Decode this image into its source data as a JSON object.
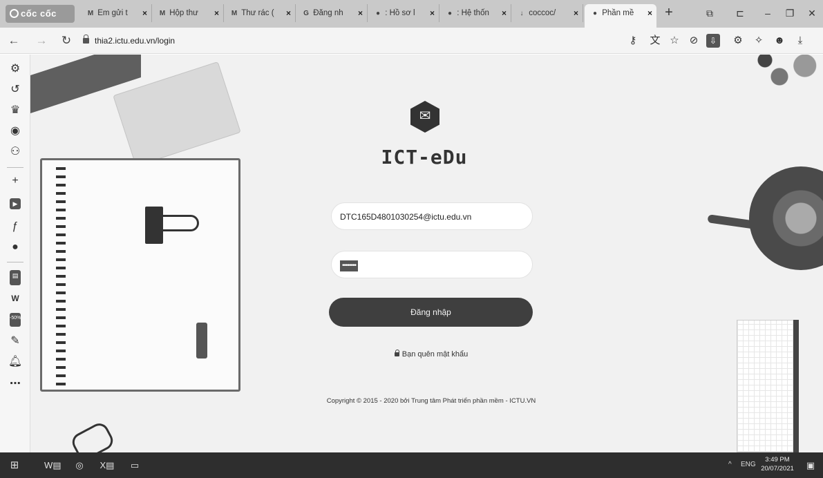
{
  "browser": {
    "brand": "cốc cốc",
    "tabs": [
      {
        "icon": "M",
        "title": "Em gửi t"
      },
      {
        "icon": "M",
        "title": "Hộp thư"
      },
      {
        "icon": "M",
        "title": "Thư rác ("
      },
      {
        "icon": "G",
        "title": "Đăng nh"
      },
      {
        "icon": "●",
        "title": ": Hồ sơ l"
      },
      {
        "icon": "●",
        "title": ": Hệ thốn"
      },
      {
        "icon": "↓",
        "title": "coccoc/"
      },
      {
        "icon": "●",
        "title": "Phần mề"
      }
    ],
    "close_glyph": "×",
    "new_tab_glyph": "+",
    "url": "thia2.ictu.edu.vn/login"
  },
  "page": {
    "brand": "ICT-eDu",
    "email_value": "DTC165D4801030254@ictu.edu.vn",
    "password_mask": "••••••••",
    "login_label": "Đăng nhập",
    "forgot_label": "Bạn quên mật khẩu",
    "copyright": "Copyright © 2015 - 2020 bởi Trung tâm Phát triển phần mềm - ICTU.VN"
  },
  "taskbar": {
    "tray_lang": "ENG",
    "time": "3:49 PM",
    "date": "20/07/2021"
  },
  "icons": {
    "back": "back-arrow-icon",
    "forward": "forward-arrow-icon",
    "reload": "reload-icon"
  }
}
